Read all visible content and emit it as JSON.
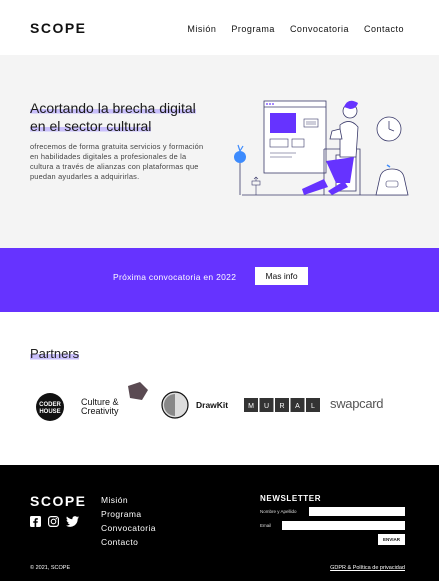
{
  "header": {
    "logo": "SCOPE",
    "nav": [
      "Misión",
      "Programa",
      "Convocatoria",
      "Contacto"
    ]
  },
  "hero": {
    "title_line1": "Acortando la brecha digital",
    "title_line2": "en el sector cultural",
    "text": "ofrecemos de forma gratuita servicios y formación en habilidades digitales a profesionales de la cultura a través de alianzas con plataformas que puedan ayudarles a adquirirlas.",
    "illustration": "person-at-computer-illustration"
  },
  "banner": {
    "text": "Próxima convocatoria en 2022",
    "button": "Mas info"
  },
  "partners": {
    "title": "Partners",
    "logos": [
      {
        "name": "coderhouse-logo",
        "text_top": "CODER",
        "text_bottom": "HOUSE"
      },
      {
        "name": "culture-creativity-logo",
        "text_top": "Culture &",
        "text_bottom": "Creativity"
      },
      {
        "name": "drawkit-logo",
        "text": "DrawKit"
      },
      {
        "name": "mural-logo",
        "letters": [
          "M",
          "U",
          "R",
          "A",
          "L"
        ]
      },
      {
        "name": "swapcard-logo",
        "text": "swapcard"
      }
    ]
  },
  "footer": {
    "logo": "SCOPE",
    "social_icons": [
      "facebook-icon",
      "instagram-icon",
      "twitter-icon"
    ],
    "nav": [
      "Misión",
      "Programa",
      "Convocatoria",
      "Contacto"
    ],
    "newsletter": {
      "title": "NEWSLETTER",
      "name_label": "Nombre y Apellido",
      "email_label": "Email",
      "button": "ENVIAR"
    },
    "copyright": "© 2021, SCOPE",
    "gdpr": "GDPR & Política de privacidad"
  },
  "colors": {
    "accent": "#6633ff",
    "highlight": "#c9bffb",
    "hero_bg": "#f4f4f4",
    "footer_bg": "#000000",
    "icon_blue": "#3d8bfd"
  }
}
